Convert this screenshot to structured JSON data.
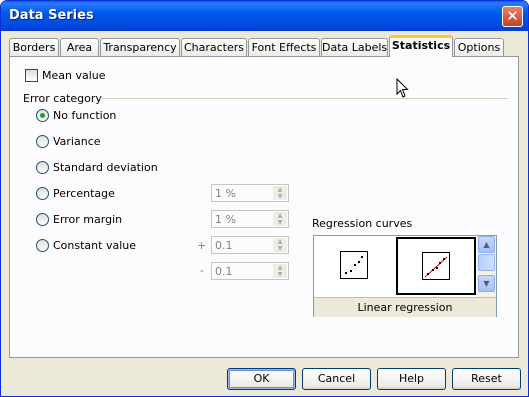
{
  "window": {
    "title": "Data Series"
  },
  "tabs": [
    {
      "label": "Borders"
    },
    {
      "label": "Area"
    },
    {
      "label": "Transparency"
    },
    {
      "label": "Characters"
    },
    {
      "label": "Font Effects"
    },
    {
      "label": "Data Labels"
    },
    {
      "label": "Statistics",
      "active": true
    },
    {
      "label": "Options"
    }
  ],
  "statistics": {
    "mean_value": {
      "label": "Mean value",
      "checked": false
    },
    "error_category": {
      "heading": "Error category",
      "options": [
        {
          "label": "No function",
          "selected": true
        },
        {
          "label": "Variance"
        },
        {
          "label": "Standard deviation"
        },
        {
          "label": "Percentage",
          "value": "1 %"
        },
        {
          "label": "Error margin",
          "value": "1 %"
        },
        {
          "label": "Constant value",
          "plus_sign": "+",
          "plus_value": "0.1",
          "minus_sign": "-",
          "minus_value": "0.1"
        }
      ]
    },
    "regression": {
      "heading": "Regression curves",
      "selected_label": "Linear regression",
      "icons": [
        "scatter-no-regression-icon",
        "linear-regression-icon"
      ]
    }
  },
  "buttons": {
    "ok": "OK",
    "cancel": "Cancel",
    "help": "Help",
    "reset": "Reset"
  },
  "colors": {
    "titlebar": "#0058ee",
    "radio_dot": "#21a121",
    "active_tab_accent": "#ffc83c",
    "regression_line": "#e00000"
  }
}
